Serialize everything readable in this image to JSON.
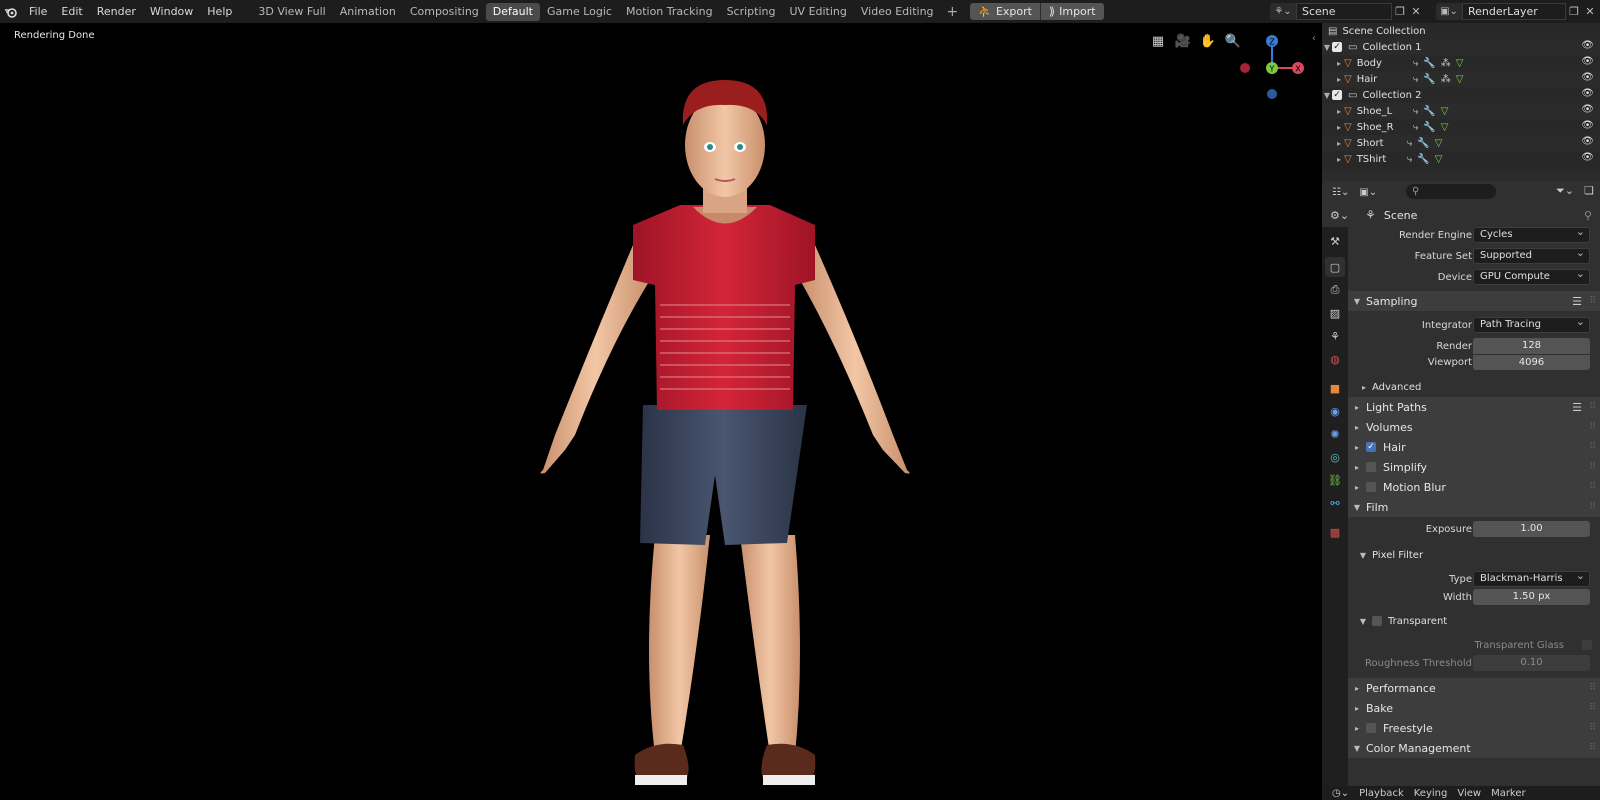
{
  "topbar": {
    "menus": [
      "File",
      "Edit",
      "Render",
      "Window",
      "Help"
    ],
    "workspaces": [
      "3D View Full",
      "Animation",
      "Compositing",
      "Default",
      "Game Logic",
      "Motion Tracking",
      "Scripting",
      "UV Editing",
      "Video Editing"
    ],
    "active_workspace": "Default",
    "export_label": "Export",
    "import_label": "Import",
    "scene_name": "Scene",
    "layer_name": "RenderLayer"
  },
  "viewport": {
    "status": "Rendering Done",
    "gizmo": {
      "z": "Z",
      "y": "Y",
      "x": "X"
    }
  },
  "outliner": {
    "root": "Scene Collection",
    "rows": [
      {
        "name": "Collection 1",
        "type": "collection"
      },
      {
        "name": "Body",
        "type": "object"
      },
      {
        "name": "Hair",
        "type": "object"
      },
      {
        "name": "Collection 2",
        "type": "collection"
      },
      {
        "name": "Shoe_L",
        "type": "object"
      },
      {
        "name": "Shoe_R",
        "type": "object"
      },
      {
        "name": "Short",
        "type": "object"
      },
      {
        "name": "TShirt",
        "type": "object"
      }
    ]
  },
  "properties": {
    "context": "Scene",
    "render_engine_label": "Render Engine",
    "render_engine": "Cycles",
    "feature_set_label": "Feature Set",
    "feature_set": "Supported",
    "device_label": "Device",
    "device": "GPU Compute",
    "sampling": "Sampling",
    "integrator_label": "Integrator",
    "integrator": "Path Tracing",
    "render_label": "Render",
    "render_samples": "128",
    "viewport_label": "Viewport",
    "viewport_samples": "4096",
    "advanced": "Advanced",
    "light_paths": "Light Paths",
    "volumes": "Volumes",
    "hair": "Hair",
    "simplify": "Simplify",
    "motion_blur": "Motion Blur",
    "film": "Film",
    "exposure_label": "Exposure",
    "exposure": "1.00",
    "pixel_filter": "Pixel Filter",
    "type_label": "Type",
    "filter_type": "Blackman-Harris",
    "width_label": "Width",
    "filter_width": "1.50 px",
    "transparent": "Transparent",
    "transparent_glass": "Transparent Glass",
    "roughness_threshold_label": "Roughness Threshold",
    "roughness_threshold": "0.10",
    "performance": "Performance",
    "bake": "Bake",
    "freestyle": "Freestyle",
    "color_management": "Color Management"
  },
  "timeline": {
    "playback": "Playback",
    "keying": "Keying",
    "view": "View",
    "marker": "Marker"
  }
}
